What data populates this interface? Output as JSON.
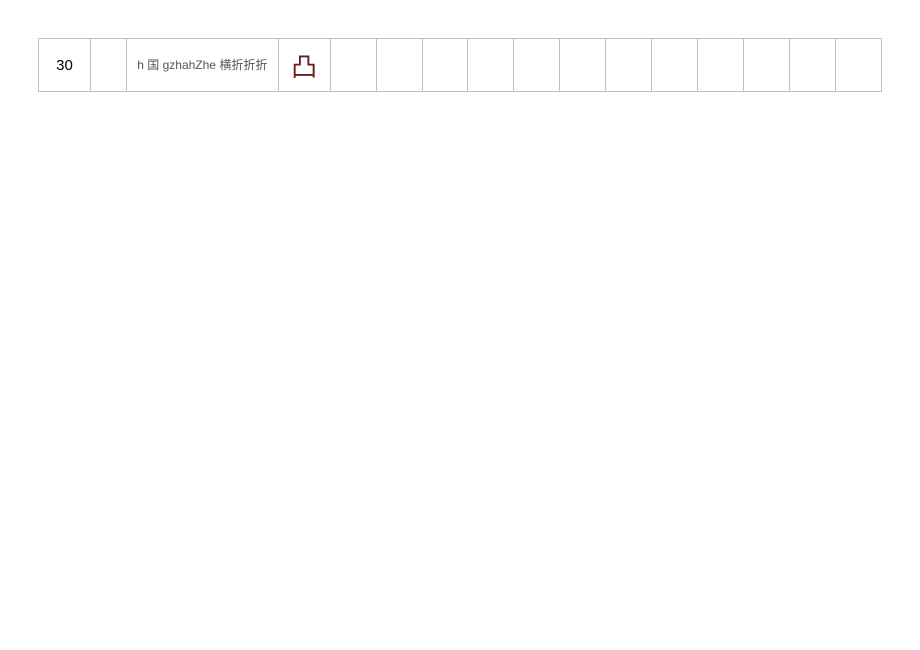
{
  "row": {
    "number": "30",
    "description": "h 国 gzhahZhe 横折折折",
    "glyph": "凸"
  }
}
